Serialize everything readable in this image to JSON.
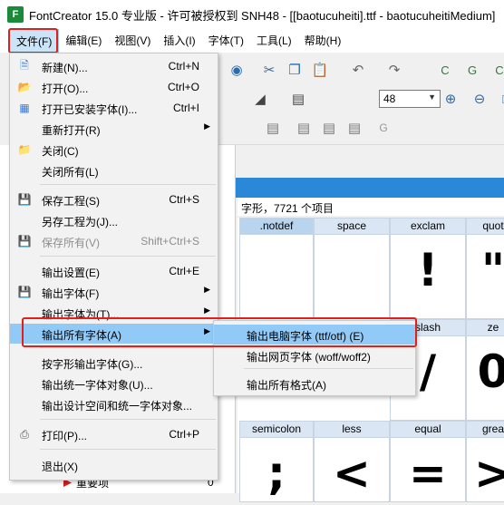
{
  "window": {
    "title": "FontCreator 15.0 专业版 - 许可被授权到 SNH48 - [[baotucuheiti].ttf - baotucuheitiMedium]",
    "app_icon": "F"
  },
  "menubar": [
    "文件(F)",
    "编辑(E)",
    "视图(V)",
    "插入(I)",
    "字体(T)",
    "工具(L)",
    "帮助(H)"
  ],
  "toolbar": {
    "font_size": "48"
  },
  "glyph_panel": {
    "header": "字形，7721 个项目"
  },
  "glyphs": [
    {
      "name": ".notdef",
      "char": ""
    },
    {
      "name": "space",
      "char": ""
    },
    {
      "name": "exclam",
      "char": "!"
    },
    {
      "name": "quot",
      "char": "\""
    },
    {
      "name": "slash",
      "char": "/"
    },
    {
      "name": "ze",
      "char": "0"
    },
    {
      "name": "semicolon",
      "char": ";"
    },
    {
      "name": "less",
      "char": "<"
    },
    {
      "name": "equal",
      "char": "="
    },
    {
      "name": "grea",
      "char": ">"
    }
  ],
  "tree": {
    "item_label": "重要项",
    "item_count": "0"
  },
  "file_menu": {
    "items": [
      {
        "icon": "new-file-icon",
        "label": "新建(N)...",
        "shortcut": "Ctrl+N"
      },
      {
        "icon": "open-folder-icon",
        "label": "打开(O)...",
        "shortcut": "Ctrl+O"
      },
      {
        "icon": "open-installed-icon",
        "label": "打开已安装字体(I)...",
        "shortcut": "Ctrl+I"
      },
      {
        "icon": "",
        "label": "重新打开(R)",
        "submenu": true
      },
      {
        "icon": "close-folder-icon",
        "label": "关闭(C)"
      },
      {
        "icon": "",
        "label": "关闭所有(L)"
      },
      {
        "icon": "save-icon",
        "label": "保存工程(S)",
        "shortcut": "Ctrl+S"
      },
      {
        "icon": "",
        "label": "另存工程为(J)..."
      },
      {
        "icon": "save-all-icon",
        "label": "保存所有(V)",
        "shortcut": "Shift+Ctrl+S",
        "disabled": true
      },
      {
        "icon": "",
        "label": "输出设置(E)",
        "shortcut": "Ctrl+E"
      },
      {
        "icon": "export-font-icon",
        "label": "输出字体(F)",
        "submenu": true
      },
      {
        "icon": "",
        "label": "输出字体为(T)...",
        "submenu": true
      },
      {
        "icon": "",
        "label": "输出所有字体(A)",
        "submenu": true,
        "highlighted": true
      },
      {
        "icon": "",
        "label": "按字形输出字体(G)..."
      },
      {
        "icon": "",
        "label": "输出统一字体对象(U)..."
      },
      {
        "icon": "",
        "label": "输出设计空间和统一字体对象..."
      },
      {
        "icon": "printer-icon",
        "label": "打印(P)...",
        "shortcut": "Ctrl+P"
      },
      {
        "icon": "",
        "label": "退出(X)"
      }
    ]
  },
  "submenu": {
    "items": [
      {
        "label": "输出电脑字体 (ttf/otf) (E)",
        "highlighted": true
      },
      {
        "label": "输出网页字体 (woff/woff2)"
      },
      {
        "label": "输出所有格式(A)"
      }
    ]
  },
  "colors": {
    "highlight": "#91c9f7",
    "annotation": "#e0201c",
    "tab_strip": "#2b88d8",
    "glyph_header": "#dae6f3"
  }
}
